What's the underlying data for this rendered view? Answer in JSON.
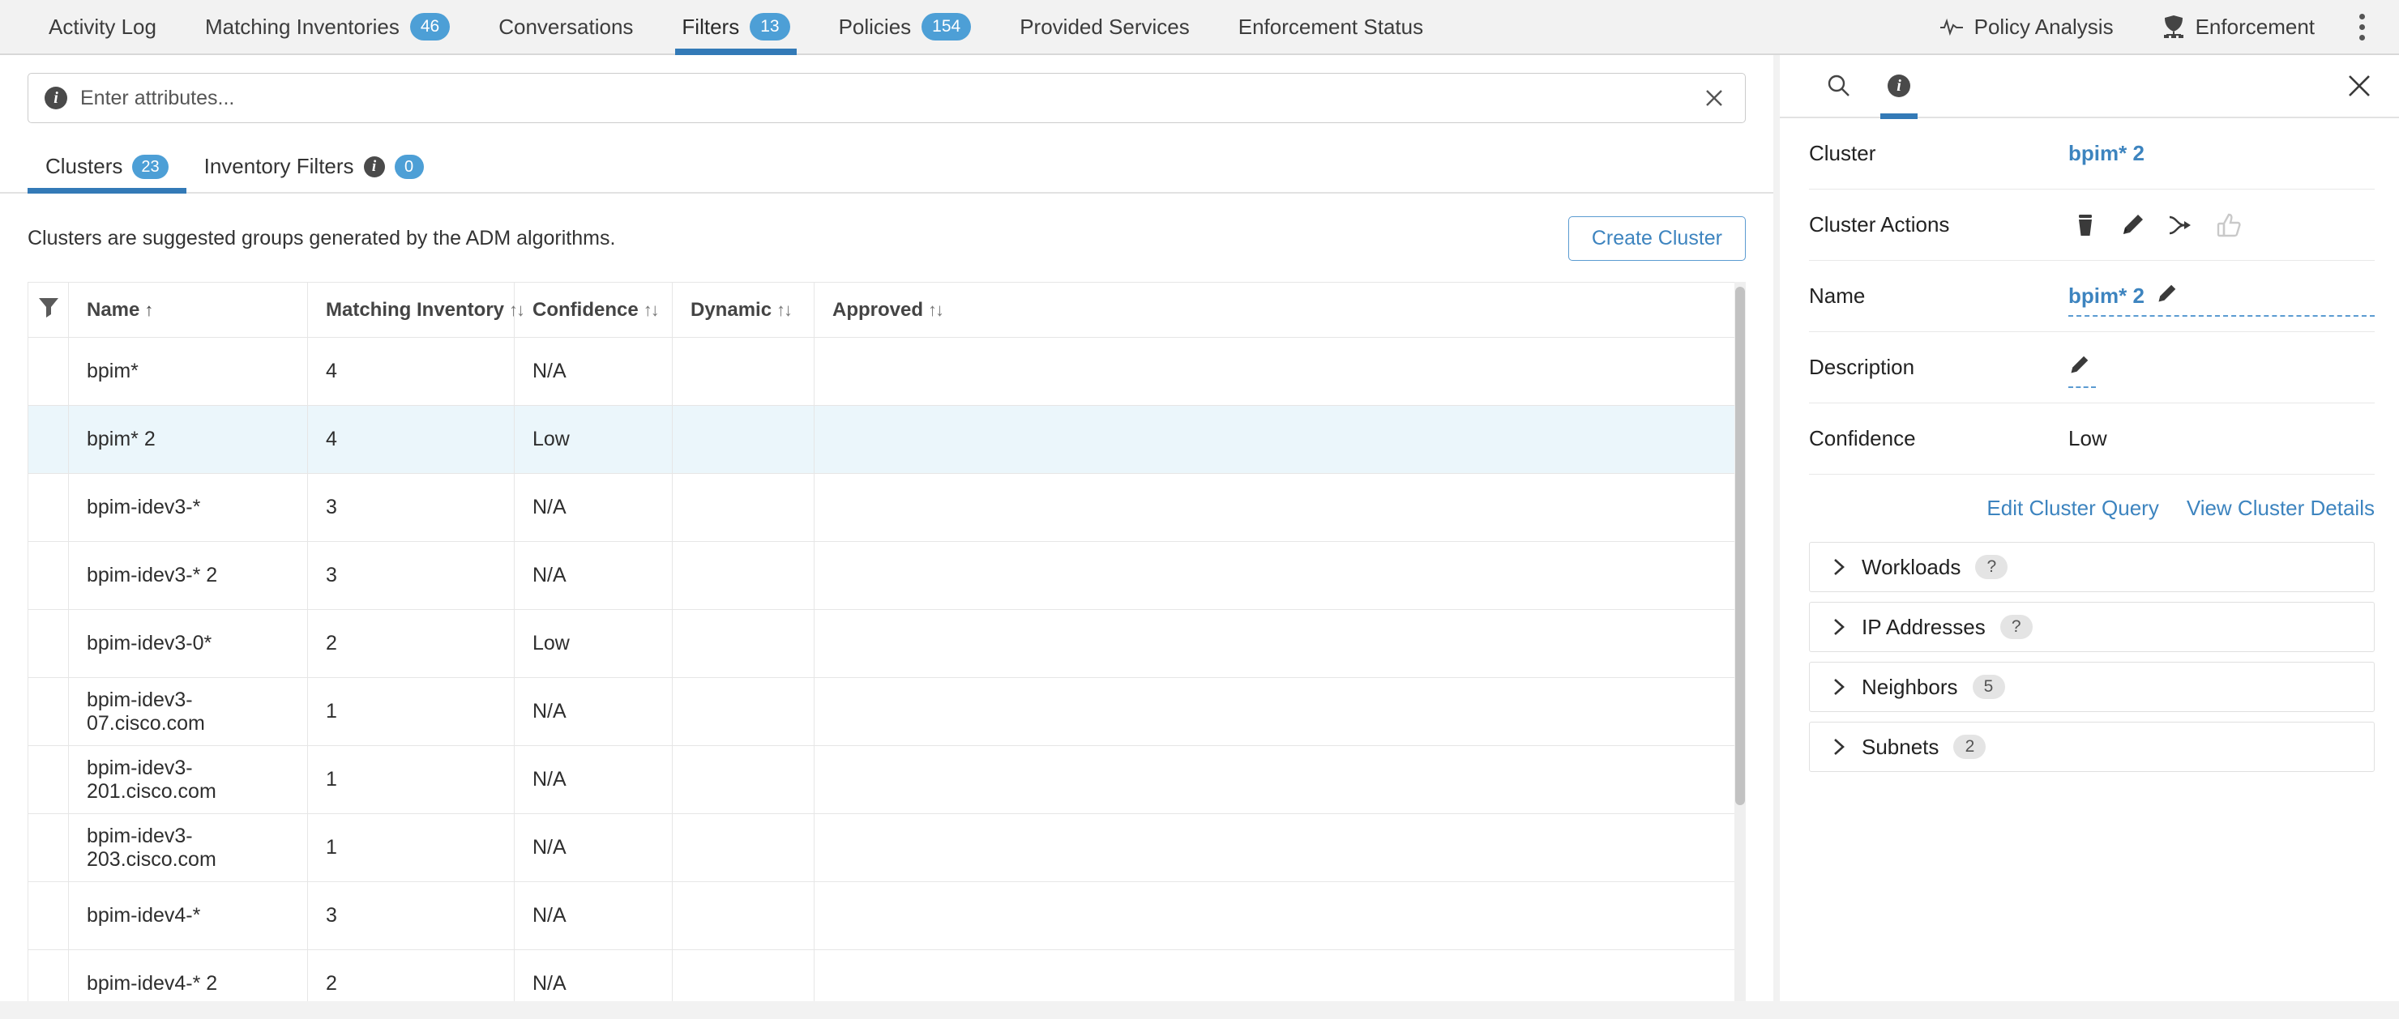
{
  "topbar": {
    "tabs": [
      {
        "label": "Activity Log",
        "count": null,
        "active": false,
        "icon": null
      },
      {
        "label": "Matching Inventories",
        "count": "46",
        "active": false,
        "icon": null
      },
      {
        "label": "Conversations",
        "count": null,
        "active": false,
        "icon": null
      },
      {
        "label": "Filters",
        "count": "13",
        "active": true,
        "icon": null
      },
      {
        "label": "Policies",
        "count": "154",
        "active": false,
        "icon": null
      },
      {
        "label": "Provided Services",
        "count": null,
        "active": false,
        "icon": null
      },
      {
        "label": "Enforcement Status",
        "count": null,
        "active": false,
        "icon": null
      }
    ],
    "right_tabs": [
      {
        "label": "Policy Analysis",
        "icon": "pulse-icon"
      },
      {
        "label": "Enforcement",
        "icon": "shield-enforcement-icon"
      }
    ],
    "overflow_menu": "kebab-menu-icon"
  },
  "attributes": {
    "placeholder": "Enter attributes...",
    "value": "",
    "info_icon": "info-icon",
    "clear_icon": "close-icon"
  },
  "subtabs": [
    {
      "label": "Clusters",
      "count": "23",
      "active": true,
      "info": false
    },
    {
      "label": "Inventory Filters",
      "count": "0",
      "active": false,
      "info": true
    }
  ],
  "main": {
    "description": "Clusters are suggested groups generated by the ADM algorithms.",
    "create_button": "Create Cluster"
  },
  "table": {
    "filter_icon": "funnel-icon",
    "columns": [
      {
        "label": "Name",
        "sort": "asc"
      },
      {
        "label": "Matching Inventory",
        "sort": "none"
      },
      {
        "label": "Confidence",
        "sort": "none"
      },
      {
        "label": "Dynamic",
        "sort": "none"
      },
      {
        "label": "Approved",
        "sort": "none"
      }
    ],
    "rows": [
      {
        "name": "bpim*",
        "matching_inventory": "4",
        "confidence": "N/A",
        "dynamic": "",
        "approved": "",
        "selected": false
      },
      {
        "name": "bpim* 2",
        "matching_inventory": "4",
        "confidence": "Low",
        "dynamic": "",
        "approved": "",
        "selected": true
      },
      {
        "name": "bpim-idev3-*",
        "matching_inventory": "3",
        "confidence": "N/A",
        "dynamic": "",
        "approved": "",
        "selected": false
      },
      {
        "name": "bpim-idev3-* 2",
        "matching_inventory": "3",
        "confidence": "N/A",
        "dynamic": "",
        "approved": "",
        "selected": false
      },
      {
        "name": "bpim-idev3-0*",
        "matching_inventory": "2",
        "confidence": "Low",
        "dynamic": "",
        "approved": "",
        "selected": false
      },
      {
        "name": "bpim-idev3-07.cisco.com",
        "matching_inventory": "1",
        "confidence": "N/A",
        "dynamic": "",
        "approved": "",
        "selected": false
      },
      {
        "name": "bpim-idev3-201.cisco.com",
        "matching_inventory": "1",
        "confidence": "N/A",
        "dynamic": "",
        "approved": "",
        "selected": false
      },
      {
        "name": "bpim-idev3-203.cisco.com",
        "matching_inventory": "1",
        "confidence": "N/A",
        "dynamic": "",
        "approved": "",
        "selected": false
      },
      {
        "name": "bpim-idev4-*",
        "matching_inventory": "3",
        "confidence": "N/A",
        "dynamic": "",
        "approved": "",
        "selected": false
      },
      {
        "name": "bpim-idev4-* 2",
        "matching_inventory": "2",
        "confidence": "N/A",
        "dynamic": "",
        "approved": "",
        "selected": false
      }
    ]
  },
  "details": {
    "header_icons": [
      {
        "name": "search-icon",
        "active": false
      },
      {
        "name": "info-icon",
        "active": true
      }
    ],
    "close_icon": "close-icon",
    "cluster_label": "Cluster",
    "cluster_value": "bpim* 2",
    "actions_label": "Cluster Actions",
    "actions": [
      {
        "name": "delete-icon"
      },
      {
        "name": "edit-icon"
      },
      {
        "name": "merge-icon"
      },
      {
        "name": "approve-thumbs-up-icon"
      }
    ],
    "name_label": "Name",
    "name_value": "bpim* 2",
    "description_label": "Description",
    "description_value": "",
    "confidence_label": "Confidence",
    "confidence_value": "Low",
    "edit_query_link": "Edit Cluster Query",
    "view_details_link": "View Cluster Details",
    "sections": [
      {
        "label": "Workloads",
        "count": "?"
      },
      {
        "label": "IP Addresses",
        "count": "?"
      },
      {
        "label": "Neighbors",
        "count": "5"
      },
      {
        "label": "Subnets",
        "count": "2"
      }
    ]
  },
  "colors": {
    "accent": "#337ab7",
    "link": "#3d84bf",
    "pill": "#4d9fd6",
    "selected_row": "#ebf6fb"
  }
}
